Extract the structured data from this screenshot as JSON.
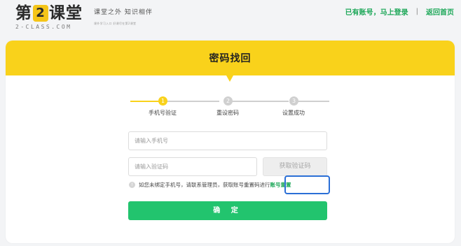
{
  "brand": {
    "logo_left": "第",
    "logo_badge": "2",
    "logo_right": "课堂",
    "logo_sub": "2-CLASS.COM",
    "slogan": "课堂之外 知识相伴",
    "slogan_sub": "课外学习入口 好课尽在第2课堂"
  },
  "top_links": {
    "has_account": "已有账号，马上登录",
    "separator": "|",
    "home": "返回首页"
  },
  "page": {
    "title": "密码找回"
  },
  "steps": [
    {
      "number": "1",
      "label": "手机号验证",
      "active": true
    },
    {
      "number": "2",
      "label": "重设密码",
      "active": false
    },
    {
      "number": "3",
      "label": "设置成功",
      "active": false
    }
  ],
  "form": {
    "phone_placeholder": "请输入手机号",
    "code_placeholder": "请输入验证码",
    "get_code_label": "获取验证码",
    "notice_text": "如您未绑定手机号，请联系管理员，获取账号重置码进行",
    "notice_link": "账号重置",
    "submit_label": "确 定"
  },
  "colors": {
    "accent_yellow": "#f9d21b",
    "accent_green": "#22c46e",
    "link_green": "#1fa85a",
    "highlight_blue": "#2b6fd6"
  }
}
